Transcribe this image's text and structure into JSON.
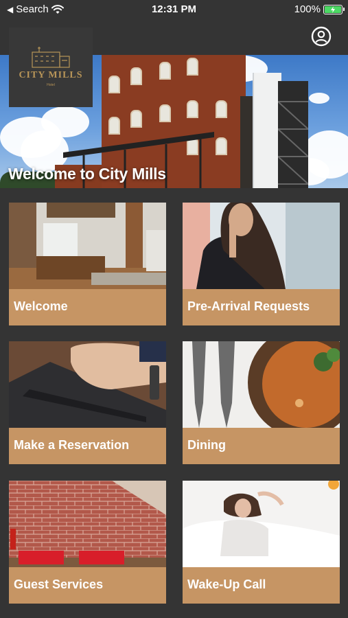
{
  "status_bar": {
    "back_app": "Search",
    "time": "12:31 PM",
    "battery": "100%"
  },
  "logo": {
    "name": "CITY MILLS",
    "subtitle": "Hotel"
  },
  "hero": {
    "title": "Welcome to City Mills"
  },
  "tiles": [
    {
      "label": "Welcome"
    },
    {
      "label": "Pre-Arrival Requests"
    },
    {
      "label": "Make a Reservation"
    },
    {
      "label": "Dining"
    },
    {
      "label": "Guest Services"
    },
    {
      "label": "Wake-Up Call"
    }
  ],
  "colors": {
    "background": "#343434",
    "tile_label": "#c69564",
    "logo_gold": "#b89558",
    "battery_green": "#4cd964"
  },
  "icons": {
    "back": "back-arrow-icon",
    "wifi": "wifi-icon",
    "battery": "battery-charging-icon",
    "profile": "user-circle-icon"
  }
}
